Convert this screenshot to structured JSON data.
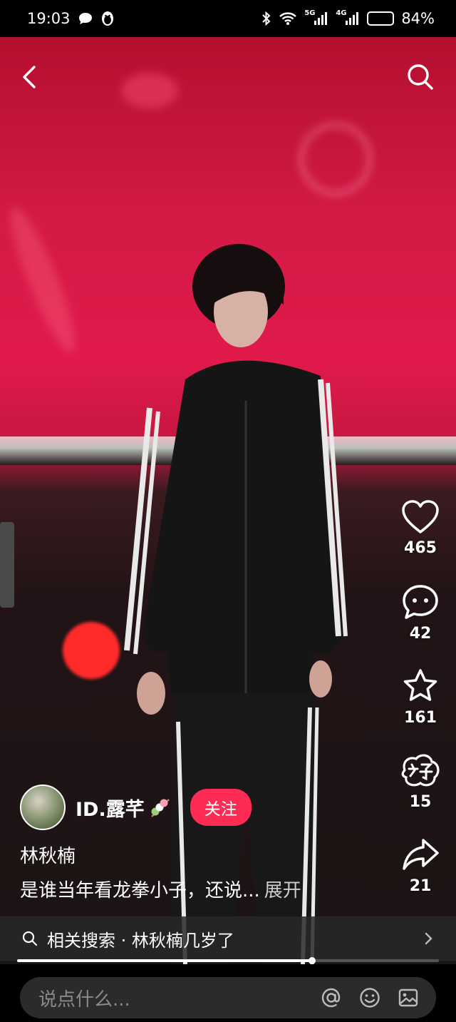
{
  "status_bar": {
    "time": "19:03",
    "battery": "84%",
    "battery_level": 0.84,
    "signal_1": "5G",
    "signal_2": "4G"
  },
  "nav": {
    "back_icon": "chevron-left-icon",
    "search_icon": "search-icon"
  },
  "actions": {
    "like_count": "465",
    "comment_count": "42",
    "favorite_count": "161",
    "good_count": "15",
    "share_count": "21"
  },
  "author": {
    "name": "ID.露芊",
    "follow_label": "关注"
  },
  "post": {
    "title": "林秋楠",
    "description": "是谁当年看龙拳小子，还说...",
    "expand_label": "展开"
  },
  "related_search": {
    "label": "相关搜索 · 林秋楠几岁了"
  },
  "playback": {
    "progress": 0.7
  },
  "comment_input": {
    "placeholder": "说点什么..."
  },
  "colors": {
    "follow": "#fe2c55",
    "stage_red": "#e01a4b"
  }
}
